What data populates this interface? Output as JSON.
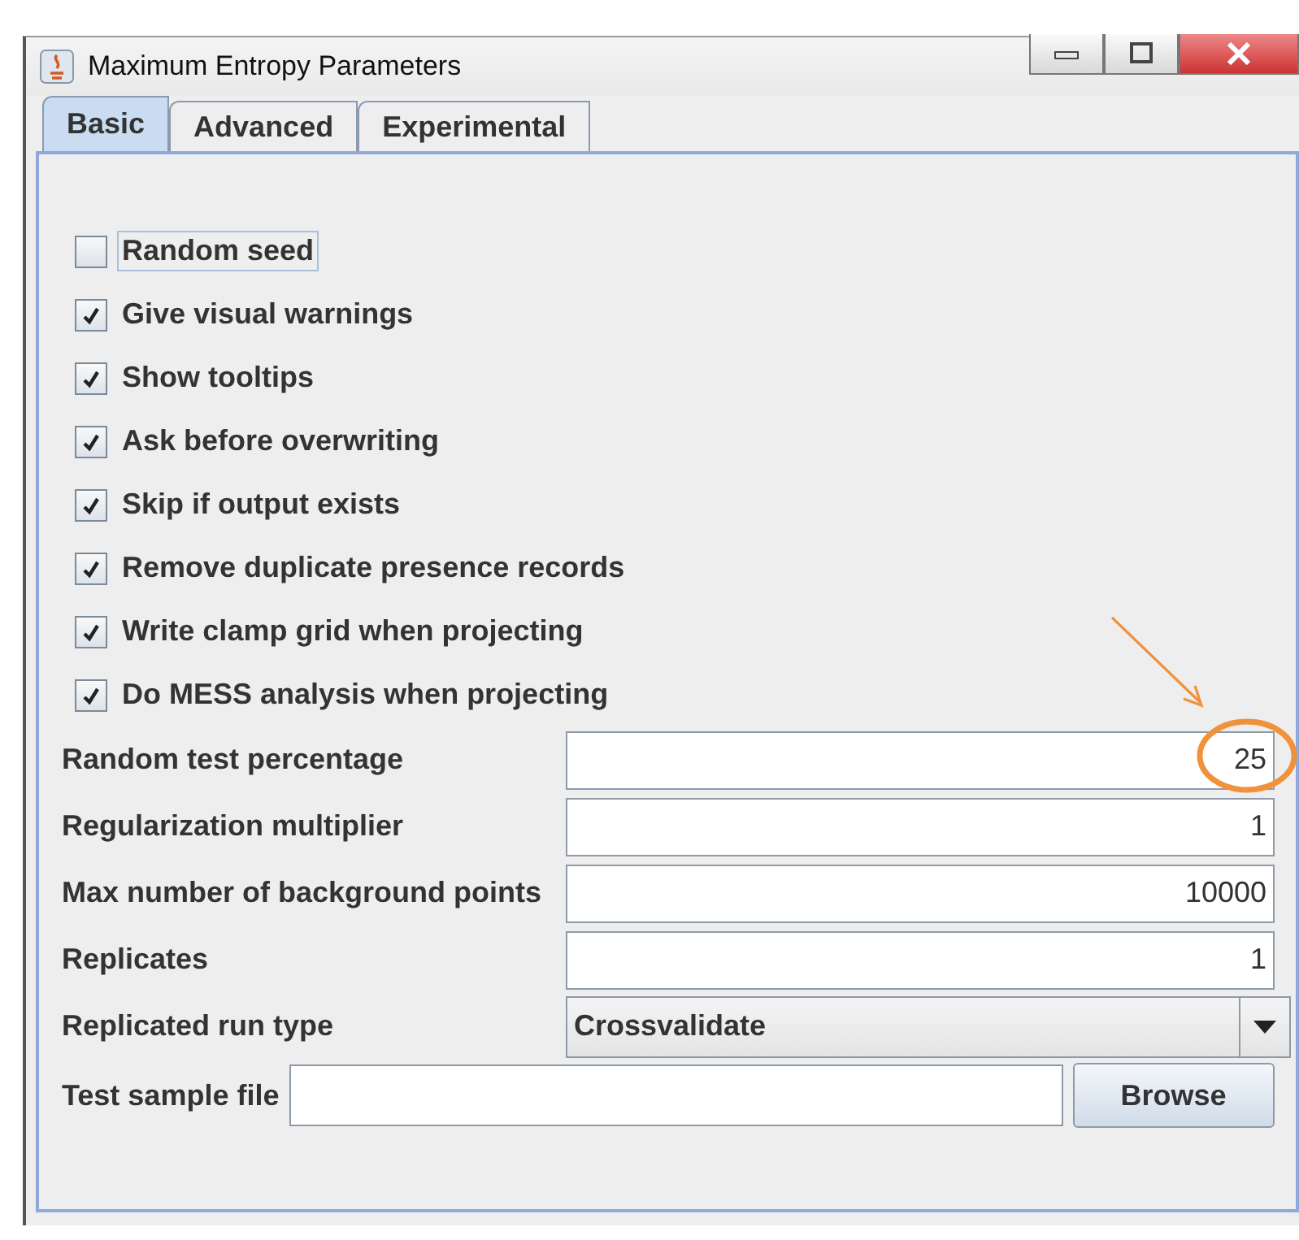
{
  "window": {
    "title": "Maximum Entropy Parameters"
  },
  "tabs": [
    {
      "label": "Basic",
      "selected": true
    },
    {
      "label": "Advanced",
      "selected": false
    },
    {
      "label": "Experimental",
      "selected": false
    }
  ],
  "checkboxes": [
    {
      "label": "Random seed",
      "checked": false,
      "focused": true
    },
    {
      "label": "Give visual warnings",
      "checked": true,
      "focused": false
    },
    {
      "label": "Show tooltips",
      "checked": true,
      "focused": false
    },
    {
      "label": "Ask before overwriting",
      "checked": true,
      "focused": false
    },
    {
      "label": "Skip if output exists",
      "checked": true,
      "focused": false
    },
    {
      "label": "Remove duplicate presence records",
      "checked": true,
      "focused": false
    },
    {
      "label": "Write clamp grid when projecting",
      "checked": true,
      "focused": false
    },
    {
      "label": "Do MESS analysis when projecting",
      "checked": true,
      "focused": false
    }
  ],
  "fields": [
    {
      "kind": "text",
      "label": "Random test percentage",
      "value": "25",
      "highlighted": true
    },
    {
      "kind": "text",
      "label": "Regularization multiplier",
      "value": "1",
      "highlighted": false
    },
    {
      "kind": "text",
      "label": "Max number of background points",
      "value": "10000",
      "highlighted": false
    },
    {
      "kind": "text",
      "label": "Replicates",
      "value": "1",
      "highlighted": false
    },
    {
      "kind": "combo",
      "label": "Replicated run type",
      "value": "Crossvalidate",
      "highlighted": false
    },
    {
      "kind": "file",
      "label": "Test sample file",
      "button": "Browse",
      "highlighted": false
    }
  ]
}
